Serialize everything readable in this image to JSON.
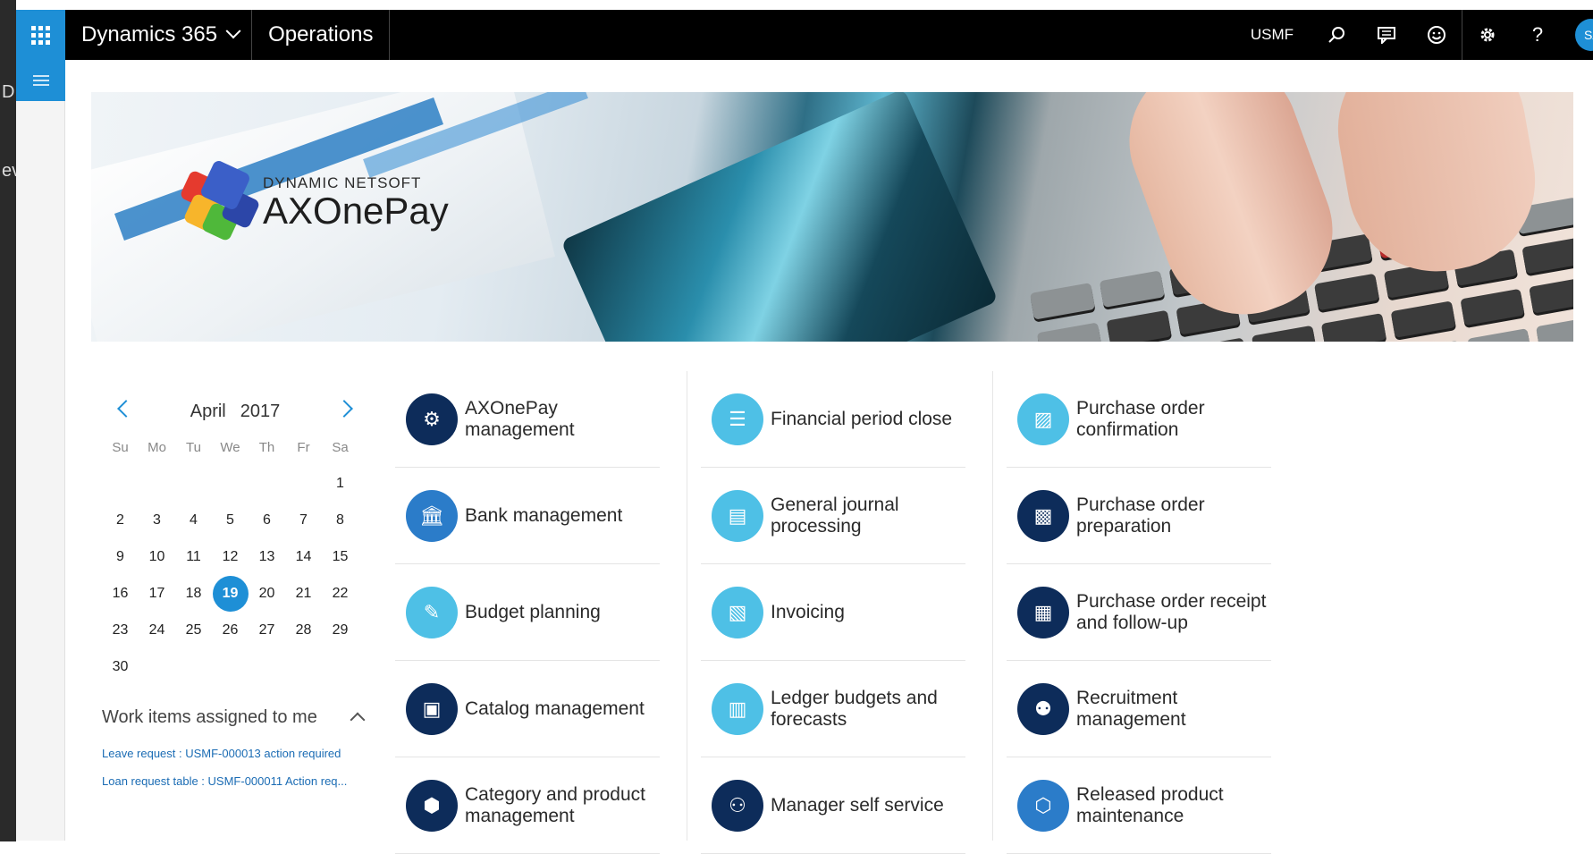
{
  "frame": {
    "ghost_char_1": "D",
    "ghost_char_2": "ev"
  },
  "navbar": {
    "app_name": "Dynamics 365",
    "module_name": "Operations",
    "company": "USMF",
    "avatar_initials": "SA",
    "icons": [
      "app-launcher-icon",
      "search-icon",
      "chat-icon",
      "smiley-icon",
      "gear-icon",
      "help-icon"
    ],
    "help_glyph": "?"
  },
  "banner": {
    "logo_subtitle": "DYNAMIC NETSOFT",
    "logo_title": "AXOnePay"
  },
  "calendar": {
    "month": "April",
    "year": "2017",
    "weekdays": [
      "Su",
      "Mo",
      "Tu",
      "We",
      "Th",
      "Fr",
      "Sa"
    ],
    "days": [
      [
        "",
        "",
        "",
        "",
        "",
        "",
        "1"
      ],
      [
        "2",
        "3",
        "4",
        "5",
        "6",
        "7",
        "8"
      ],
      [
        "9",
        "10",
        "11",
        "12",
        "13",
        "14",
        "15"
      ],
      [
        "16",
        "17",
        "18",
        "19",
        "20",
        "21",
        "22"
      ],
      [
        "23",
        "24",
        "25",
        "26",
        "27",
        "28",
        "29"
      ],
      [
        "30",
        "",
        "",
        "",
        "",
        "",
        ""
      ]
    ],
    "selected_day": "19"
  },
  "work_items": {
    "title": "Work items assigned to me",
    "items": [
      "Leave request : USMF-000013 action required",
      "Loan request table : USMF-000011 Action req..."
    ]
  },
  "tiles": {
    "col1": [
      {
        "label": "AXOnePay management",
        "icon": "people-settings-icon",
        "tone": "dark"
      },
      {
        "label": "Bank management",
        "icon": "bank-icon",
        "tone": "mid"
      },
      {
        "label": "Budget planning",
        "icon": "budget-edit-icon",
        "tone": "light"
      },
      {
        "label": "Catalog management",
        "icon": "catalog-icon",
        "tone": "dark"
      },
      {
        "label": "Category and product management",
        "icon": "product-box-icon",
        "tone": "dark"
      }
    ],
    "col2": [
      {
        "label": "Financial period close",
        "icon": "checklist-icon",
        "tone": "light"
      },
      {
        "label": "General journal processing",
        "icon": "journal-icon",
        "tone": "light"
      },
      {
        "label": "Invoicing",
        "icon": "invoice-icon",
        "tone": "light"
      },
      {
        "label": "Ledger budgets and forecasts",
        "icon": "ledger-icon",
        "tone": "light"
      },
      {
        "label": "Manager self service",
        "icon": "manager-team-icon",
        "tone": "dark"
      }
    ],
    "col3": [
      {
        "label": "Purchase order confirmation",
        "icon": "document-check-icon",
        "tone": "light"
      },
      {
        "label": "Purchase order preparation",
        "icon": "document-prep-icon",
        "tone": "dark"
      },
      {
        "label": "Purchase order receipt and follow-up",
        "icon": "document-receipt-icon",
        "tone": "dark"
      },
      {
        "label": "Recruitment management",
        "icon": "recruit-icon",
        "tone": "dark"
      },
      {
        "label": "Released product maintenance",
        "icon": "cube-icon",
        "tone": "mid"
      }
    ]
  },
  "colors": {
    "accent": "#1e8fd6",
    "navbar_bg": "#000000",
    "tile_dark": "#0d2c5a",
    "tile_mid": "#2b7cc9",
    "tile_light": "#4ec0e6",
    "link": "#1b6cb4"
  }
}
